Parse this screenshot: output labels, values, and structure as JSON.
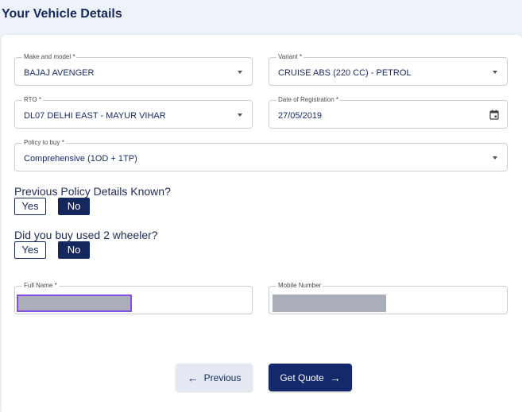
{
  "page_title": "Your Vehicle Details",
  "fields": {
    "make_model": {
      "label": "Make and model *",
      "value": "BAJAJ AVENGER"
    },
    "variant": {
      "label": "Variant *",
      "value": "CRUISE ABS (220 CC) - PETROL"
    },
    "rto": {
      "label": "RTO *",
      "value": "DL07 DELHI EAST - MAYUR VIHAR"
    },
    "registration_date": {
      "label": "Date of Registration *",
      "value": "27/05/2019"
    },
    "policy": {
      "label": "Policy to buy *",
      "value": "Comprehensive (1OD + 1TP)"
    },
    "full_name": {
      "label": "Full Name *"
    },
    "mobile": {
      "label": "Mobile Number"
    }
  },
  "questions": {
    "previous_policy": {
      "text": "Previous Policy Details Known?",
      "yes": "Yes",
      "no": "No",
      "selected": "No"
    },
    "used_vehicle": {
      "text": "Did you buy used 2 wheeler?",
      "yes": "Yes",
      "no": "No",
      "selected": "No"
    }
  },
  "buttons": {
    "previous": {
      "label": "Previous",
      "icon": "arrow-left-icon"
    },
    "get_quote": {
      "label": "Get Quote",
      "icon": "arrow-right-icon"
    }
  },
  "colors": {
    "primary": "#13296b",
    "focus": "#8a4ee8",
    "redacted": "#a9aeb9"
  }
}
